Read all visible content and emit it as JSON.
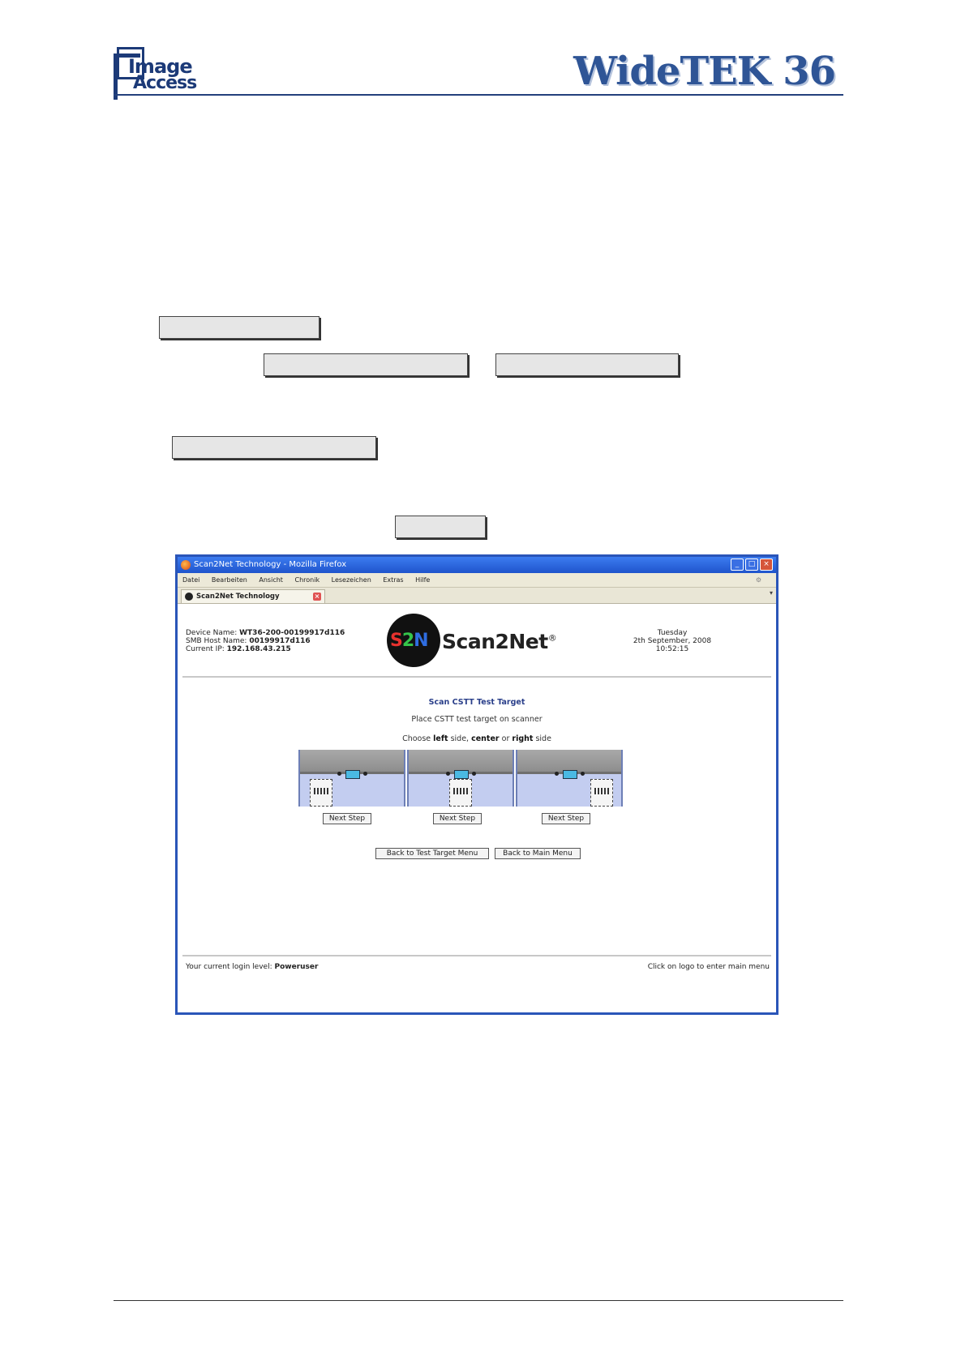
{
  "doc_header": {
    "logo_line1": "Image",
    "logo_line2": "Access",
    "product_title": "WideTEK 36"
  },
  "browser": {
    "window_title": "Scan2Net Technology - Mozilla Firefox",
    "controls": {
      "minimize": "_",
      "maximize": "□",
      "close": "×"
    },
    "menu_items": [
      "Datei",
      "Bearbeiten",
      "Ansicht",
      "Chronik",
      "Lesezeichen",
      "Extras",
      "Hilfe"
    ],
    "tab_label": "Scan2Net Technology"
  },
  "device_info": {
    "device_name_label": "Device Name:",
    "device_name": "WT36-200-00199917d116",
    "smb_host_label": "SMB Host Name:",
    "smb_host": "00199917d116",
    "ip_label": "Current IP:",
    "ip": "192.168.43.215"
  },
  "logo": {
    "letters": [
      "S",
      "2",
      "N"
    ],
    "letter_colors": [
      "#e8322e",
      "#35c44a",
      "#2f6de0"
    ],
    "brand_text": "Scan2Net",
    "registered": "®"
  },
  "datetime": {
    "day": "Tuesday",
    "date": "2th September, 2008",
    "time": "10:52:15"
  },
  "panel": {
    "title": "Scan CSTT Test Target",
    "instruction": "Place CSTT test target on scanner",
    "choose_prefix": "Choose",
    "opt_left": "left",
    "choose_mid1": "side,",
    "opt_center": "center",
    "choose_mid2": "or",
    "opt_right": "right",
    "choose_suffix": "side"
  },
  "scan_options": [
    {
      "position": "left",
      "button_label": "Next Step"
    },
    {
      "position": "center",
      "button_label": "Next Step"
    },
    {
      "position": "right",
      "button_label": "Next Step"
    }
  ],
  "nav_buttons": {
    "back_test_target": "Back to Test Target Menu",
    "back_main": "Back to Main Menu"
  },
  "footer": {
    "login_label": "Your current login level:",
    "login_level": "Poweruser",
    "hint": "Click on logo to enter main menu"
  }
}
